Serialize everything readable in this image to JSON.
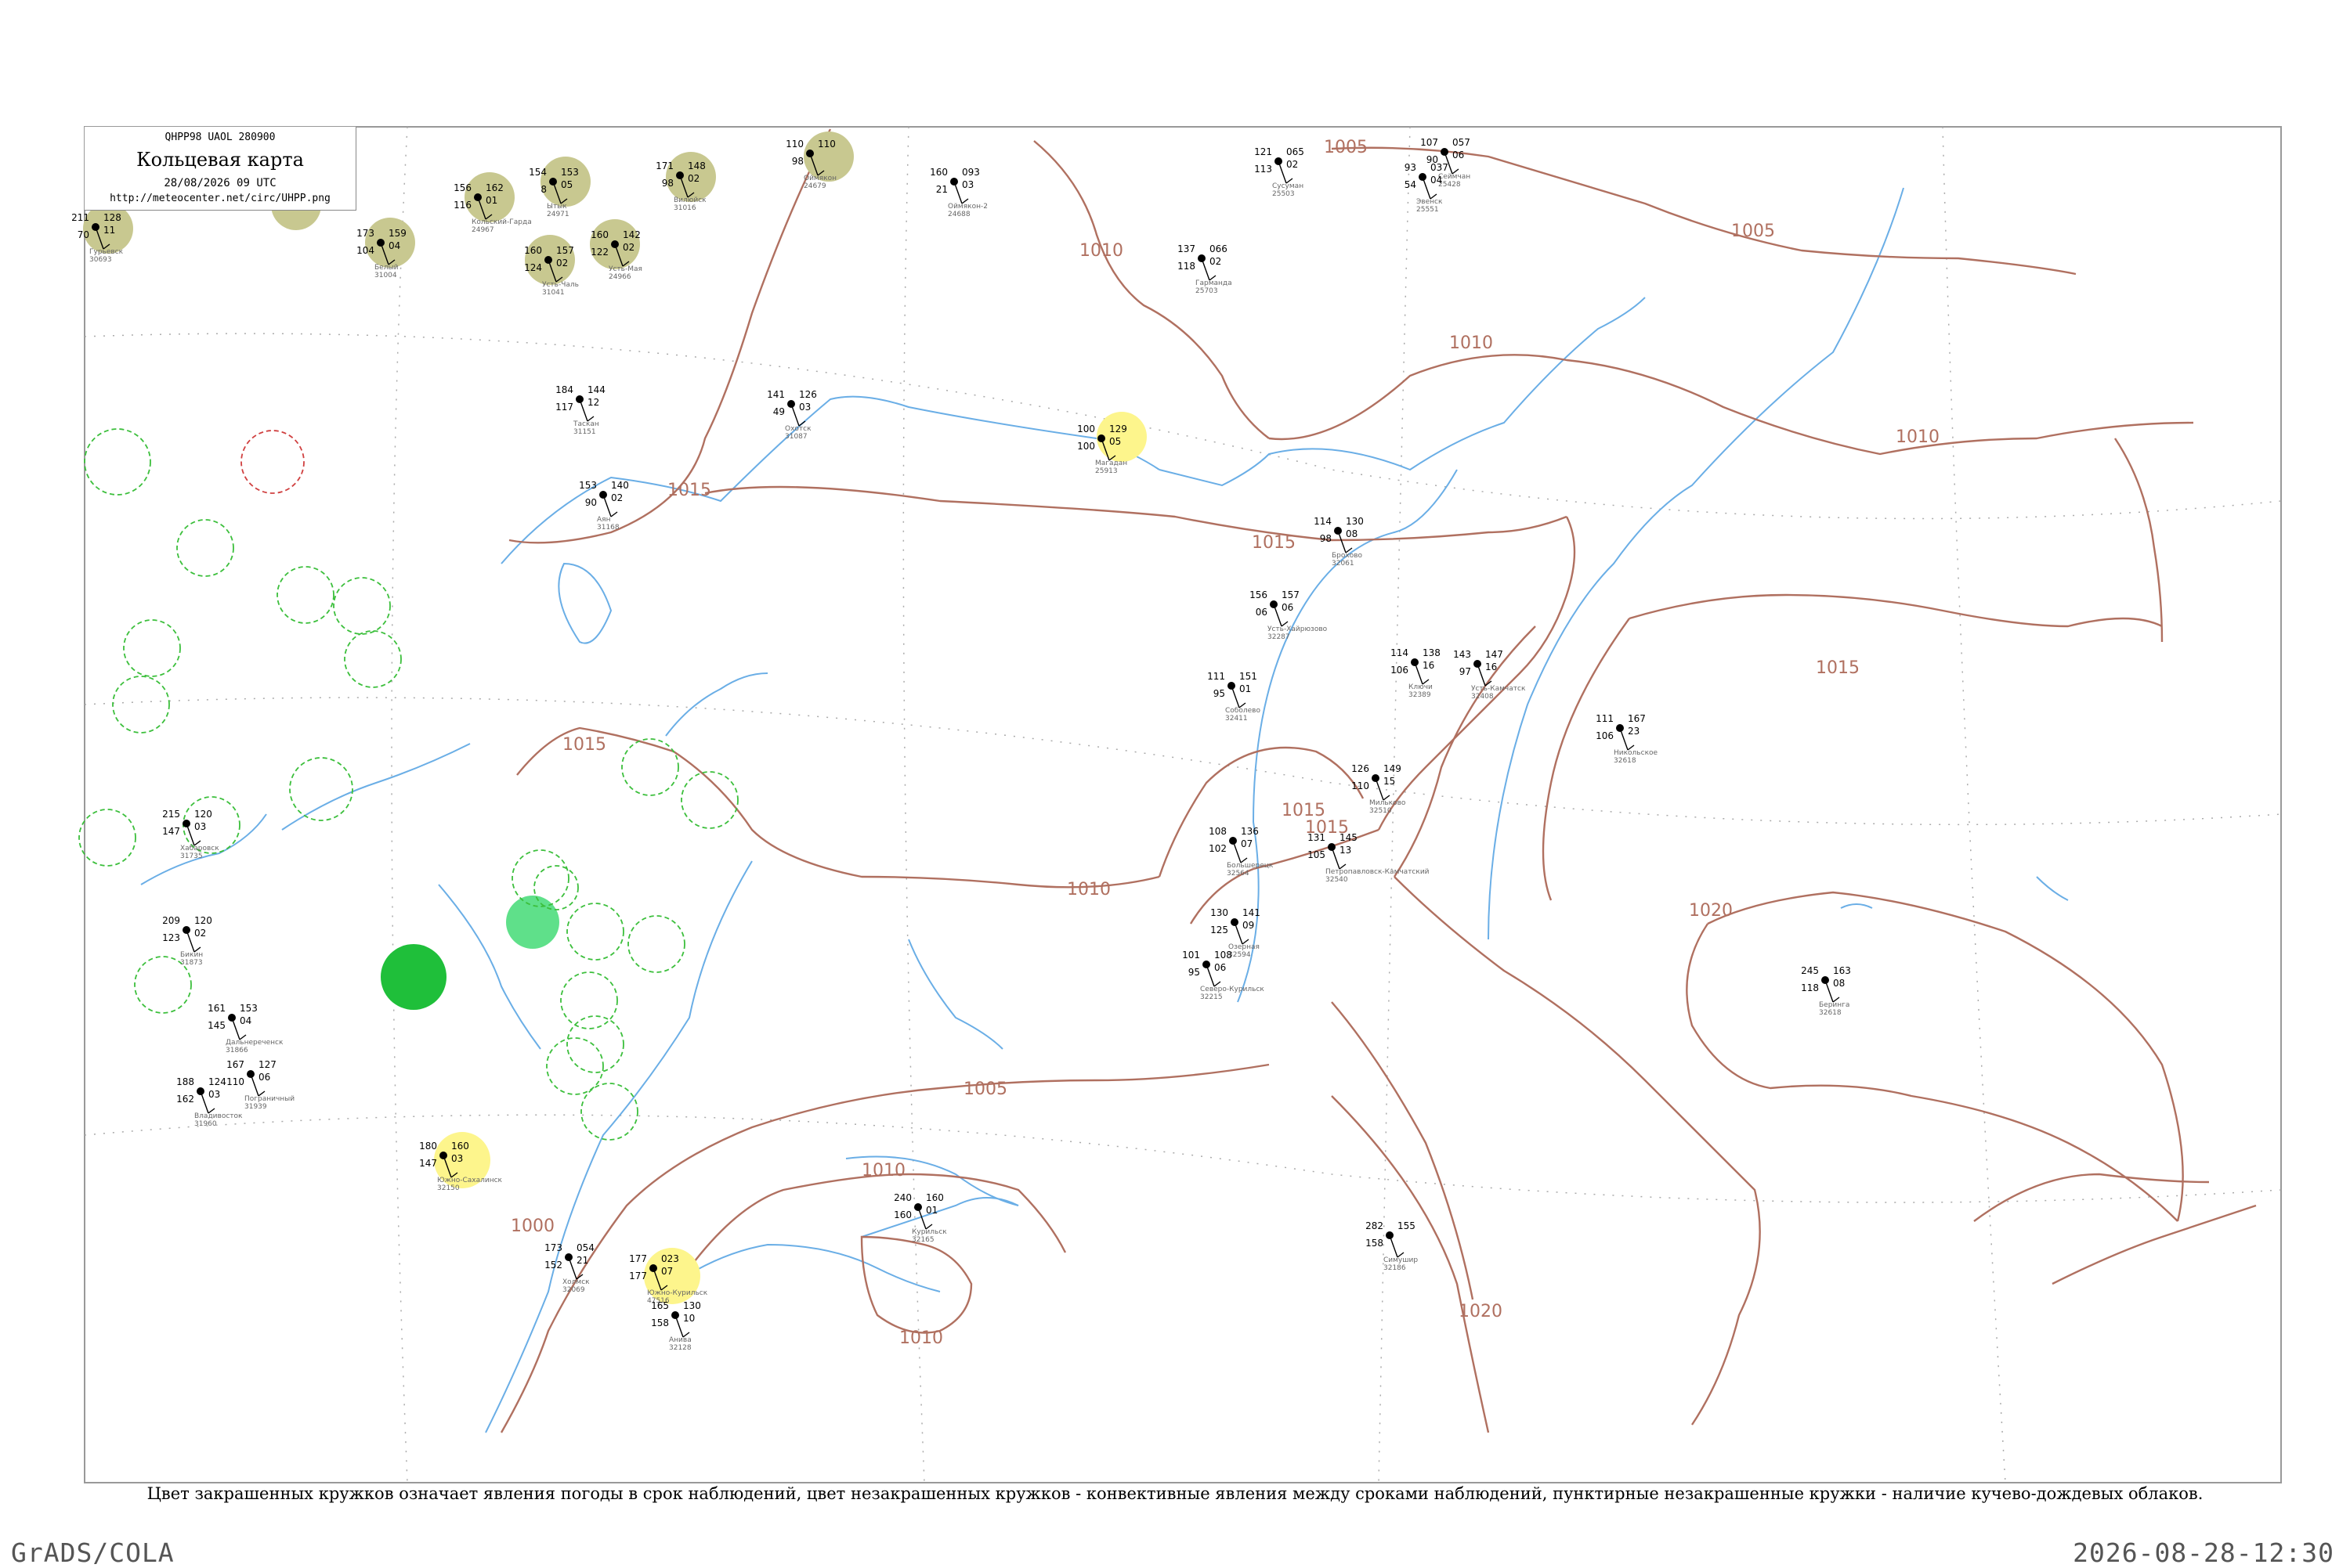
{
  "header": {
    "code": "QHPP98  UAOL  280900",
    "title": "Кольцевая карта",
    "date": "28/08/2026 09 UTC",
    "url": "http://meteocenter.net/circ/UHPP.png"
  },
  "caption": "Цвет закрашенных кружков означает явления погоды в срок наблюдений, цвет незакрашенных кружков - конвективные явления между сроками наблюдений, пунктирные незакрашенные кружки - наличие кучево-дождевых облаков.",
  "footer": {
    "left": "GrADS/COLA",
    "right": "2026-08-28-12:30"
  },
  "colors": {
    "isobar": "#b07060",
    "river": "#6aaee6",
    "frame": "#999999",
    "khaki": "#c8c890",
    "yellow": "#fdf58c",
    "green_light": "#5fe08a",
    "green_dark": "#1fbf3a",
    "dashed_green": "#3cbf3c",
    "dashed_red": "#d04040"
  },
  "isobar_labels": [
    {
      "id": "iso-1005-top",
      "text": "1005"
    },
    {
      "id": "iso-1005-right",
      "text": "1005"
    },
    {
      "id": "iso-1010-a",
      "text": "1010"
    },
    {
      "id": "iso-1010-b",
      "text": "1010"
    },
    {
      "id": "iso-1010-c",
      "text": "1010"
    },
    {
      "id": "iso-1015-a",
      "text": "1015"
    },
    {
      "id": "iso-1015-b",
      "text": "1015"
    },
    {
      "id": "iso-1015-c",
      "text": "1015"
    },
    {
      "id": "iso-1015-d",
      "text": "1015"
    },
    {
      "id": "iso-1015-e",
      "text": "1015"
    },
    {
      "id": "iso-1015-f",
      "text": "1015"
    },
    {
      "id": "iso-1010-d",
      "text": "1010"
    },
    {
      "id": "iso-1005-mid",
      "text": "1005"
    },
    {
      "id": "iso-1010-e",
      "text": "1010"
    },
    {
      "id": "iso-1000",
      "text": "1000"
    },
    {
      "id": "iso-1010-f",
      "text": "1010"
    },
    {
      "id": "iso-1020-a",
      "text": "1020"
    },
    {
      "id": "iso-1020-b",
      "text": "1020"
    }
  ],
  "stations": [
    {
      "name": "Гурьевск",
      "index": "30693",
      "t": "211",
      "p": "128",
      "d": "70",
      "ptend": "11"
    },
    {
      "name": "Белый",
      "index": "31004",
      "t": "173",
      "p": "159",
      "d": "104",
      "ptend": "04"
    },
    {
      "name": "Вилюйск",
      "index": "31016",
      "t": "171",
      "p": "148",
      "d": "98",
      "ptend": "02"
    },
    {
      "name": "Кольский-Гарда",
      "index": "24967",
      "t": "156",
      "p": "162",
      "d": "116",
      "ptend": "01"
    },
    {
      "name": "Ытык",
      "index": "24971",
      "t": "154",
      "p": "153",
      "d": "8",
      "ptend": "05"
    },
    {
      "name": "Усть-Мая",
      "index": "24966",
      "t": "160",
      "p": "142",
      "d": "122",
      "ptend": "02"
    },
    {
      "name": "Усть-Чаль",
      "index": "31041",
      "t": "160",
      "p": "157",
      "d": "124",
      "ptend": "02"
    },
    {
      "name": "Оймякон",
      "index": "24679",
      "t": "110",
      "p": "110",
      "d": "98",
      "ptend": ""
    },
    {
      "name": "Оймякон-2",
      "index": "24688",
      "t": "160",
      "p": "093",
      "d": "21",
      "ptend": "03"
    },
    {
      "name": "Сусуман",
      "index": "25503",
      "t": "121",
      "p": "065",
      "d": "113",
      "ptend": "02"
    },
    {
      "name": "Сеймчан",
      "index": "25428",
      "t": "107",
      "p": "057",
      "d": "90",
      "ptend": "06"
    },
    {
      "name": "Эвенск",
      "index": "25551",
      "t": "93",
      "p": "037",
      "d": "54",
      "ptend": "04"
    },
    {
      "name": "Гарманда",
      "index": "25703",
      "t": "137",
      "p": "066",
      "d": "118",
      "ptend": "02"
    },
    {
      "name": "Таскан",
      "index": "31151",
      "t": "184",
      "p": "144",
      "d": "117",
      "ptend": "12"
    },
    {
      "name": "Аян",
      "index": "31168",
      "t": "153",
      "p": "140",
      "d": "90",
      "ptend": "02"
    },
    {
      "name": "Охотск",
      "index": "31087",
      "t": "141",
      "p": "126",
      "d": "49",
      "ptend": "03"
    },
    {
      "name": "Магадан",
      "index": "25913",
      "t": "100",
      "p": "129",
      "d": "100",
      "ptend": "05"
    },
    {
      "name": "Брохово",
      "index": "32061",
      "t": "114",
      "p": "130",
      "d": "98",
      "ptend": "08"
    },
    {
      "name": "Усть-Хайрюзово",
      "index": "32287",
      "t": "156",
      "p": "157",
      "d": "06",
      "ptend": "06"
    },
    {
      "name": "Ключи",
      "index": "32389",
      "t": "114",
      "p": "138",
      "d": "106",
      "ptend": "16"
    },
    {
      "name": "Усть-Камчатск",
      "index": "32408",
      "t": "143",
      "p": "147",
      "d": "97",
      "ptend": "16"
    },
    {
      "name": "Никольское",
      "index": "32618",
      "t": "111",
      "p": "167",
      "d": "106",
      "ptend": "23"
    },
    {
      "name": "Соболево",
      "index": "32411",
      "t": "111",
      "p": "151",
      "d": "95",
      "ptend": "01"
    },
    {
      "name": "Мильково",
      "index": "32510",
      "t": "126",
      "p": "149",
      "d": "110",
      "ptend": "15"
    },
    {
      "name": "Петропавловск-Камчатский",
      "index": "32540",
      "t": "131",
      "p": "145",
      "d": "105",
      "ptend": "13"
    },
    {
      "name": "Большерецк",
      "index": "32564",
      "t": "108",
      "p": "136",
      "d": "102",
      "ptend": "07"
    },
    {
      "name": "Озерная",
      "index": "32594",
      "t": "130",
      "p": "141",
      "d": "125",
      "ptend": "09"
    },
    {
      "name": "Северо-Курильск",
      "index": "32215",
      "t": "101",
      "p": "108",
      "d": "95",
      "ptend": "06"
    },
    {
      "name": "Беринга",
      "index": "32618",
      "t": "245",
      "p": "163",
      "d": "118",
      "ptend": "08"
    },
    {
      "name": "Курильск",
      "index": "32165",
      "t": "240",
      "p": "160",
      "d": "160",
      "ptend": "01"
    },
    {
      "name": "Южно-Курильск",
      "index": "47516",
      "t": "177",
      "p": "023",
      "d": "177",
      "ptend": "07"
    },
    {
      "name": "Симушир",
      "index": "32186",
      "t": "282",
      "p": "155",
      "d": "158",
      "ptend": ""
    },
    {
      "name": "Южно-Сахалинск",
      "index": "32150",
      "t": "180",
      "p": "160",
      "d": "147",
      "ptend": "03"
    },
    {
      "name": "Холмск",
      "index": "32069",
      "t": "173",
      "p": "054",
      "d": "152",
      "ptend": "21"
    },
    {
      "name": "Анива",
      "index": "32128",
      "t": "165",
      "p": "130",
      "d": "158",
      "ptend": "10"
    },
    {
      "name": "Хабаровск",
      "index": "31735",
      "t": "215",
      "p": "120",
      "d": "147",
      "ptend": "03"
    },
    {
      "name": "Бикин",
      "index": "31873",
      "t": "209",
      "p": "120",
      "d": "123",
      "ptend": "02"
    },
    {
      "name": "Дальнереченск",
      "index": "31866",
      "t": "161",
      "p": "153",
      "d": "145",
      "ptend": "04"
    },
    {
      "name": "Владивосток",
      "index": "31960",
      "t": "188",
      "p": "124",
      "d": "162",
      "ptend": "03"
    },
    {
      "name": "Пограничный",
      "index": "31939",
      "t": "167",
      "p": "127",
      "d": "110",
      "ptend": "06"
    }
  ]
}
